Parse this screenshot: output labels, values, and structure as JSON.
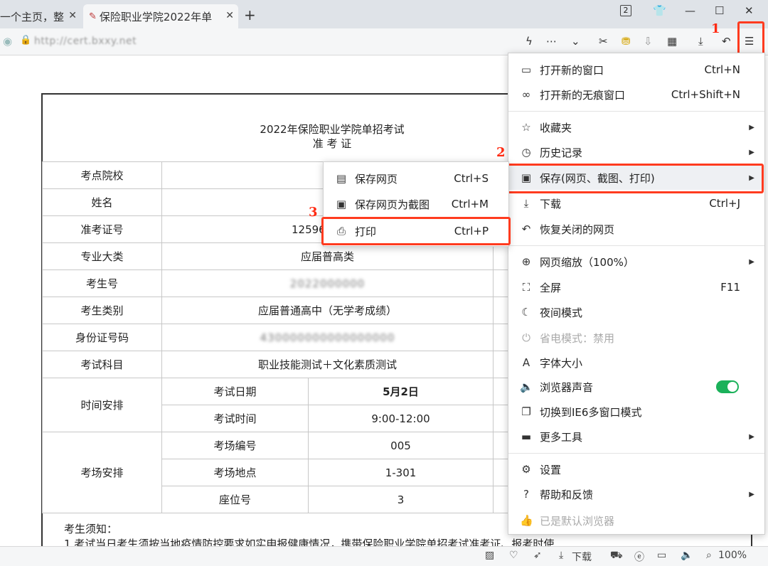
{
  "tabs": [
    {
      "label": "一个主页，整",
      "close": "✕"
    },
    {
      "label": "保险职业学院2022年单",
      "close": "✕"
    }
  ],
  "tabbar": {
    "new_tab": "+",
    "tab_count": "2"
  },
  "address": {
    "url": "http://cert.bxxy.net"
  },
  "annotations": {
    "step1": "1",
    "step2": "2",
    "step3": "3"
  },
  "ticket": {
    "title_line1": "2022年保险职业学院单招考试",
    "title_line2": "准 考 证",
    "rows": {
      "school_label": "考点院校",
      "name_label": "姓名",
      "ticket_no_label": "准考证号",
      "ticket_no_value": "12596",
      "major_label": "专业大类",
      "major_value": "应届普高类",
      "exam_no_label": "考生号",
      "exam_no_value": "2022000000",
      "category_label": "考生类别",
      "category_value": "应届普通高中（无学考成绩）",
      "id_label": "身份证号码",
      "id_value": "430000000000000000",
      "subject_label": "考试科目",
      "subject_value": "职业技能测试＋文化素质测试",
      "schedule_label": "时间安排",
      "exam_date_label": "考试日期",
      "exam_date_value": "5月2日",
      "exam_time_label": "考试时间",
      "exam_time_value": "9:00-12:00",
      "room_label": "考场安排",
      "room_no_label": "考场编号",
      "room_no_value": "005",
      "room_loc_label": "考场地点",
      "room_loc_value": "1-301",
      "seat_label": "座位号",
      "seat_value": "3"
    },
    "notice_title": "考生须知：",
    "notice_line1": "1.考试当日考生须按当地疫情防控要求如实申报健康情况，携带保险职业学院单招考试准考证、报考时使"
  },
  "menu": {
    "items": [
      {
        "label": "打开新的窗口",
        "shortcut": "Ctrl+N"
      },
      {
        "label": "打开新的无痕窗口",
        "shortcut": "Ctrl+Shift+N"
      },
      {
        "label": "收藏夹"
      },
      {
        "label": "历史记录"
      },
      {
        "label": "保存(网页、截图、打印)"
      },
      {
        "label": "下载",
        "shortcut": "Ctrl+J"
      },
      {
        "label": "恢复关闭的网页"
      },
      {
        "label": "网页缩放（100%）"
      },
      {
        "label": "全屏",
        "shortcut": "F11"
      },
      {
        "label": "夜间模式"
      },
      {
        "label": "省电模式：禁用"
      },
      {
        "label": "字体大小"
      },
      {
        "label": "浏览器声音"
      },
      {
        "label": "切换到IE6多窗口模式"
      },
      {
        "label": "更多工具"
      },
      {
        "label": "设置"
      },
      {
        "label": "帮助和反馈"
      },
      {
        "label": "已是默认浏览器"
      }
    ]
  },
  "submenu": {
    "items": [
      {
        "label": "保存网页",
        "shortcut": "Ctrl+S"
      },
      {
        "label": "保存网页为截图",
        "shortcut": "Ctrl+M"
      },
      {
        "label": "打印",
        "shortcut": "Ctrl+P"
      }
    ]
  },
  "statusbar": {
    "download_label": "下载",
    "zoom": "100%"
  },
  "colors": {
    "highlight": "#ff3b1f",
    "toggle_on": "#1bb15a"
  },
  "icons": [
    "window-icon",
    "incognito-icon",
    "star-icon",
    "clock-icon",
    "save-image-icon",
    "download-icon",
    "undo-icon",
    "zoom-icon",
    "fullscreen-icon",
    "moon-icon",
    "power-icon",
    "font-icon",
    "speaker-icon",
    "ie-window-icon",
    "toolbox-icon",
    "gear-icon",
    "help-icon",
    "thumb-icon",
    "menu-icon",
    "scissors-icon",
    "printer-icon"
  ]
}
